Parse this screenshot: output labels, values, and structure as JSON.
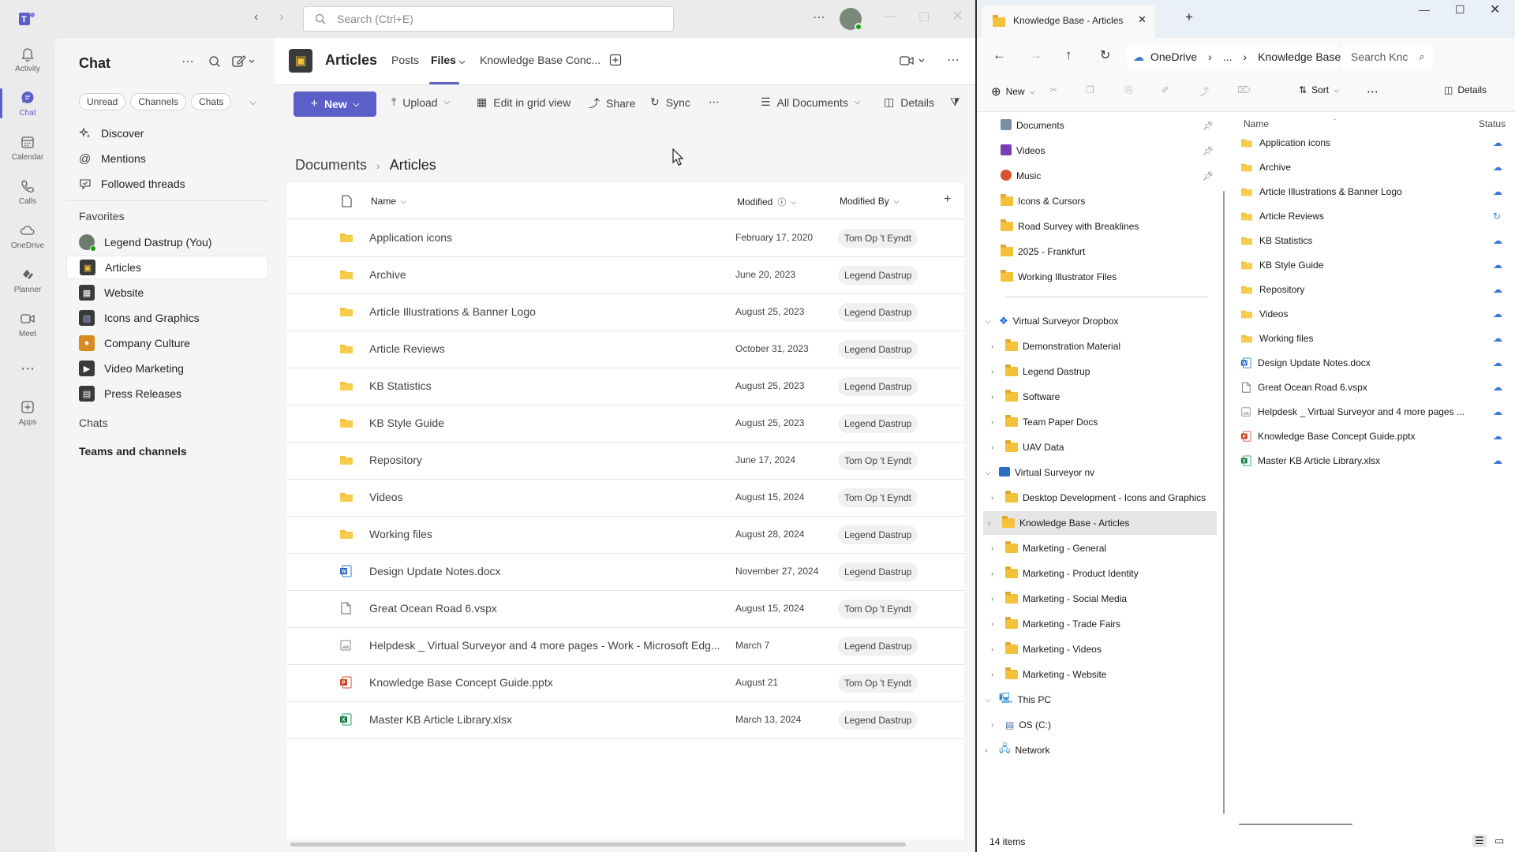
{
  "teams": {
    "search_placeholder": "Search (Ctrl+E)",
    "rail": [
      {
        "label": "Activity",
        "icon": "bell-icon"
      },
      {
        "label": "Chat",
        "icon": "chat-icon",
        "active": true
      },
      {
        "label": "Calendar",
        "icon": "calendar-icon"
      },
      {
        "label": "Calls",
        "icon": "phone-icon"
      },
      {
        "label": "OneDrive",
        "icon": "cloud-icon"
      },
      {
        "label": "Planner",
        "icon": "planner-icon"
      },
      {
        "label": "Meet",
        "icon": "video-icon"
      },
      {
        "label": "Apps",
        "icon": "apps-icon"
      }
    ],
    "chat_title": "Chat",
    "filters": [
      "Unread",
      "Channels",
      "Chats"
    ],
    "nav": [
      {
        "label": "Discover",
        "icon": "discover-icon"
      },
      {
        "label": "Mentions",
        "icon": "at-icon"
      },
      {
        "label": "Followed threads",
        "icon": "followed-icon"
      }
    ],
    "favorites_label": "Favorites",
    "favorites": [
      {
        "label": "Legend Dastrup (You)"
      },
      {
        "label": "Articles",
        "selected": true
      },
      {
        "label": "Website"
      },
      {
        "label": "Icons and Graphics"
      },
      {
        "label": "Company Culture"
      },
      {
        "label": "Video Marketing"
      },
      {
        "label": "Press Releases"
      }
    ],
    "chats_label": "Chats",
    "teams_channels_label": "Teams and channels",
    "channel": {
      "name": "Articles",
      "tabs": [
        "Posts",
        "Files",
        "Knowledge Base Conc..."
      ],
      "active_tab": "Files"
    },
    "commands": {
      "new": "New",
      "upload": "Upload",
      "edit_grid": "Edit in grid view",
      "share": "Share",
      "sync": "Sync",
      "view": "All Documents",
      "details": "Details"
    },
    "breadcrumb": {
      "root": "Documents",
      "current": "Articles"
    },
    "columns": {
      "name": "Name",
      "modified": "Modified",
      "modified_by": "Modified By"
    },
    "files": [
      {
        "type": "folder",
        "name": "Application icons",
        "modified": "February 17, 2020",
        "by": "Tom Op 't Eyndt"
      },
      {
        "type": "folder",
        "name": "Archive",
        "modified": "June 20, 2023",
        "by": "Legend Dastrup"
      },
      {
        "type": "folder",
        "name": "Article Illustrations & Banner Logo",
        "modified": "August 25, 2023",
        "by": "Legend Dastrup"
      },
      {
        "type": "folder",
        "name": "Article Reviews",
        "modified": "October 31, 2023",
        "by": "Legend Dastrup"
      },
      {
        "type": "folder",
        "name": "KB Statistics",
        "modified": "August 25, 2023",
        "by": "Legend Dastrup"
      },
      {
        "type": "folder",
        "name": "KB Style Guide",
        "modified": "August 25, 2023",
        "by": "Legend Dastrup"
      },
      {
        "type": "folder",
        "name": "Repository",
        "modified": "June 17, 2024",
        "by": "Tom Op 't Eyndt"
      },
      {
        "type": "folder",
        "name": "Videos",
        "modified": "August 15, 2024",
        "by": "Tom Op 't Eyndt"
      },
      {
        "type": "folder",
        "name": "Working files",
        "modified": "August 28, 2024",
        "by": "Legend Dastrup"
      },
      {
        "type": "word",
        "name": "Design Update Notes.docx",
        "modified": "November 27, 2024",
        "by": "Legend Dastrup"
      },
      {
        "type": "file",
        "name": "Great Ocean Road 6.vspx",
        "modified": "August 15, 2024",
        "by": "Tom Op 't Eyndt"
      },
      {
        "type": "image",
        "name": "Helpdesk _ Virtual Surveyor and 4 more pages - Work - Microsoft Edg...",
        "modified": "March 7",
        "by": "Legend Dastrup"
      },
      {
        "type": "ppt",
        "name": "Knowledge Base Concept Guide.pptx",
        "modified": "August 21",
        "by": "Tom Op 't Eyndt"
      },
      {
        "type": "excel",
        "name": "Master KB Article Library.xlsx",
        "modified": "March 13, 2024",
        "by": "Legend Dastrup"
      }
    ]
  },
  "explorer": {
    "tab_title": "Knowledge Base - Articles",
    "address": [
      "OneDrive",
      "...",
      "Knowledge Base - Arti"
    ],
    "search_placeholder": "Search Knc",
    "toolbar": {
      "new": "New",
      "sort": "Sort",
      "details": "Details"
    },
    "quick_access": [
      {
        "label": "Documents",
        "pinned": true
      },
      {
        "label": "Videos",
        "pinned": true
      },
      {
        "label": "Music",
        "pinned": true
      },
      {
        "label": "Icons & Cursors"
      },
      {
        "label": "Road Survey with Breaklines"
      },
      {
        "label": "2025 - Frankfurt"
      },
      {
        "label": "Working Illustrator Files"
      }
    ],
    "tree": [
      {
        "label": "Virtual Surveyor Dropbox",
        "level": 0,
        "expanded": true
      },
      {
        "label": "Demonstration Material",
        "level": 1
      },
      {
        "label": "Legend Dastrup",
        "level": 1
      },
      {
        "label": "Software",
        "level": 1
      },
      {
        "label": "Team Paper Docs",
        "level": 1
      },
      {
        "label": "UAV Data",
        "level": 1
      },
      {
        "label": "Virtual Surveyor nv",
        "level": 0,
        "expanded": true
      },
      {
        "label": "Desktop Development - Icons and Graphics",
        "level": 1
      },
      {
        "label": "Knowledge Base - Articles",
        "level": 1,
        "selected": true
      },
      {
        "label": "Marketing - General",
        "level": 1
      },
      {
        "label": "Marketing - Product Identity",
        "level": 1
      },
      {
        "label": "Marketing - Social Media",
        "level": 1
      },
      {
        "label": "Marketing - Trade Fairs",
        "level": 1
      },
      {
        "label": "Marketing - Videos",
        "level": 1
      },
      {
        "label": "Marketing - Website",
        "level": 1
      },
      {
        "label": "This PC",
        "level": 0,
        "expanded": true
      },
      {
        "label": "OS (C:)",
        "level": 1
      },
      {
        "label": "Network",
        "level": 0
      }
    ],
    "columns": {
      "name": "Name",
      "status": "Status"
    },
    "files": [
      {
        "type": "folder",
        "name": "Application icons"
      },
      {
        "type": "folder",
        "name": "Archive"
      },
      {
        "type": "folder",
        "name": "Article Illustrations & Banner Logo"
      },
      {
        "type": "folder",
        "name": "Article Reviews",
        "syncing": true
      },
      {
        "type": "folder",
        "name": "KB Statistics"
      },
      {
        "type": "folder",
        "name": "KB Style Guide"
      },
      {
        "type": "folder",
        "name": "Repository"
      },
      {
        "type": "folder",
        "name": "Videos"
      },
      {
        "type": "folder",
        "name": "Working files"
      },
      {
        "type": "word",
        "name": "Design Update Notes.docx"
      },
      {
        "type": "file",
        "name": "Great Ocean Road 6.vspx"
      },
      {
        "type": "image",
        "name": "Helpdesk _ Virtual Surveyor and 4 more pages ..."
      },
      {
        "type": "ppt",
        "name": "Knowledge Base Concept Guide.pptx"
      },
      {
        "type": "excel",
        "name": "Master KB Article Library.xlsx"
      }
    ],
    "status_text": "14 items"
  },
  "colors": {
    "accent": "#5b5fc7",
    "folder": "#f3c13a",
    "cloud": "#3a7bd5"
  }
}
